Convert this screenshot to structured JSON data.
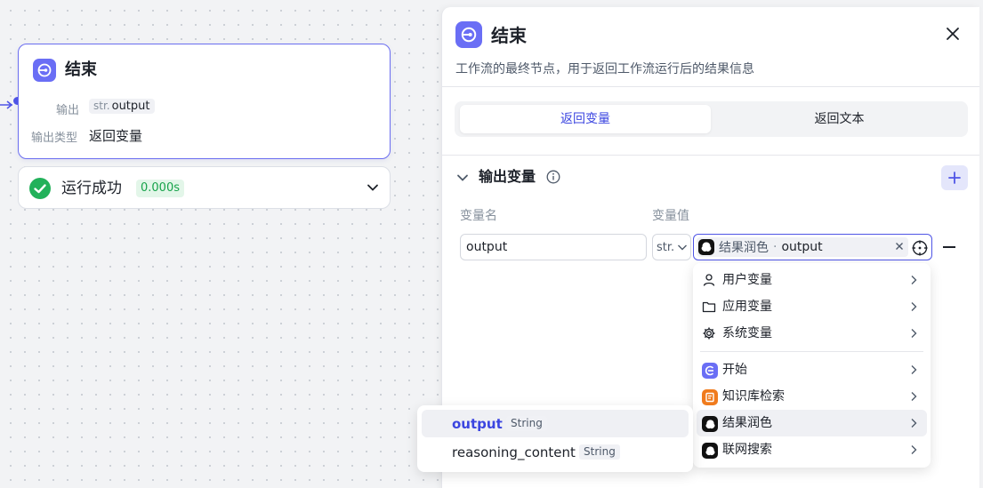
{
  "node": {
    "title": "结束",
    "output_label": "输出",
    "output_type": "str.",
    "output_name": "output",
    "output_type_label": "输出类型",
    "output_type_value": "返回变量"
  },
  "run": {
    "status": "运行成功",
    "time": "0.000s"
  },
  "panel": {
    "title": "结束",
    "description": "工作流的最终节点，用于返回工作流运行后的结果信息",
    "tabs": [
      {
        "label": "返回变量",
        "active": true
      },
      {
        "label": "返回文本",
        "active": false
      }
    ],
    "section_title": "输出变量",
    "col_name": "变量名",
    "col_value": "变量值",
    "row": {
      "name": "output",
      "type": "str.",
      "source": "结果润色",
      "sep": "·",
      "variable": "output"
    }
  },
  "menu": {
    "items": [
      {
        "label": "用户变量",
        "icon": "user-icon"
      },
      {
        "label": "应用变量",
        "icon": "folder-icon"
      },
      {
        "label": "系统变量",
        "icon": "gear-icon"
      },
      {
        "label": "开始",
        "icon": "start-node-icon"
      },
      {
        "label": "知识库检索",
        "icon": "knowledge-base-icon"
      },
      {
        "label": "结果润色",
        "icon": "llm-node-icon",
        "hover": true
      },
      {
        "label": "联网搜索",
        "icon": "llm-node-icon"
      }
    ]
  },
  "submenu": {
    "items": [
      {
        "name": "output",
        "type": "String",
        "selected": true
      },
      {
        "name": "reasoning_content",
        "type": "String",
        "selected": false
      }
    ]
  },
  "colors": {
    "accent": "#4f55e6",
    "node_icon": "#6a6ef5",
    "success": "#22b15a",
    "knowledge": "#f07b1d"
  }
}
